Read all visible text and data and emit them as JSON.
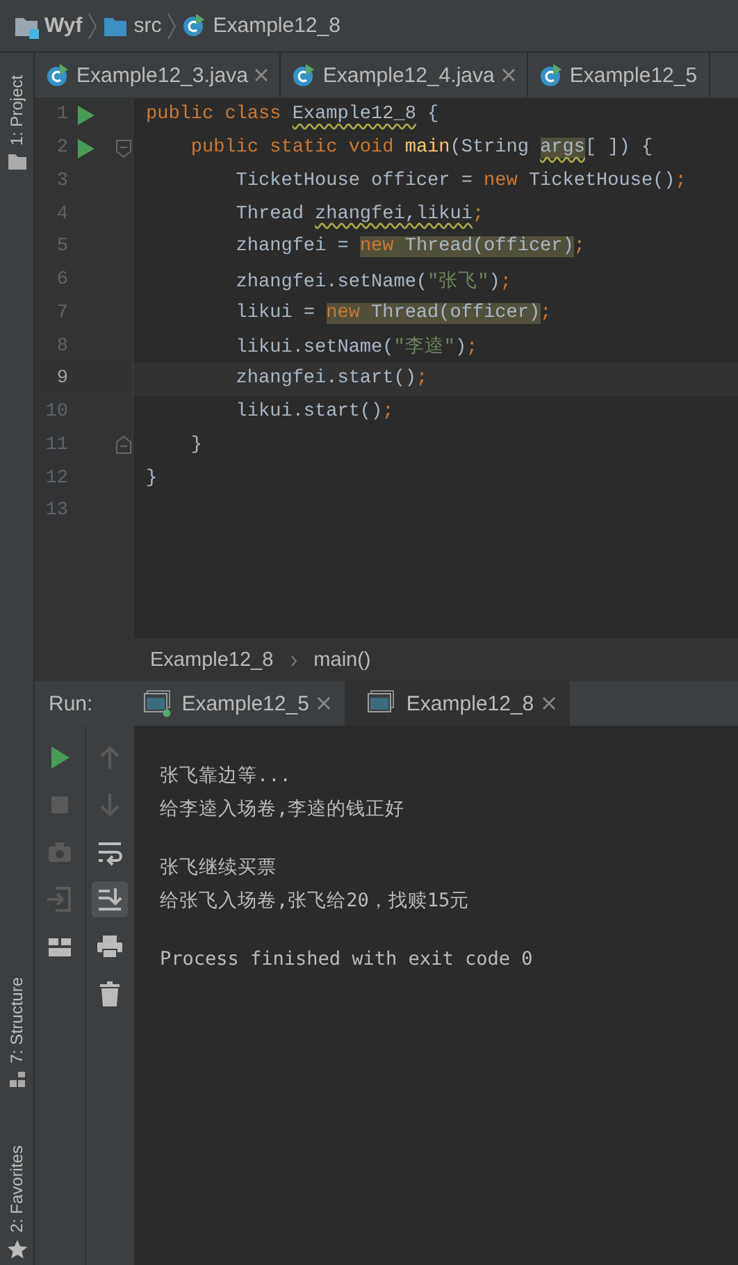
{
  "breadcrumbs": [
    {
      "label": "Wyf",
      "kind": "project"
    },
    {
      "label": "src",
      "kind": "folder"
    },
    {
      "label": "Example12_8",
      "kind": "class"
    }
  ],
  "side_tools": [
    {
      "label": "1: Project",
      "kind": "project"
    },
    {
      "label": "7: Structure",
      "kind": "structure"
    },
    {
      "label": "2: Favorites",
      "kind": "favorites"
    }
  ],
  "editor_tabs": [
    {
      "label": "Example12_3.java",
      "selected": false
    },
    {
      "label": "Example12_4.java",
      "selected": false
    },
    {
      "label": "Example12_5",
      "selected": false
    }
  ],
  "code": [
    {
      "number": "1",
      "run": true,
      "current": false,
      "segments": [
        {
          "t": "public class ",
          "kind": "kw"
        },
        {
          "t": "Example12_8",
          "kind": "warn"
        },
        {
          "t": " {",
          "kind": "txt"
        }
      ]
    },
    {
      "number": "2",
      "run": true,
      "fold": {
        "kind": "start"
      },
      "current": false,
      "segments": [
        {
          "t": "    public static void ",
          "kind": "kw"
        },
        {
          "t": "main",
          "kind": "fn"
        },
        {
          "t": "(String ",
          "kind": "txt"
        },
        {
          "t": "args",
          "kind": "warn-hl"
        },
        {
          "t": "[ ]) {",
          "kind": "txt"
        }
      ]
    },
    {
      "number": "3",
      "run": false,
      "current": false,
      "segments": [
        {
          "t": "        TicketHouse officer = ",
          "kind": "txt"
        },
        {
          "t": "new ",
          "kind": "kw"
        },
        {
          "t": "TicketHouse()",
          "kind": "txt"
        },
        {
          "t": ";",
          "kind": "semi"
        }
      ]
    },
    {
      "number": "4",
      "run": false,
      "current": false,
      "segments": [
        {
          "t": "        Thread ",
          "kind": "txt"
        },
        {
          "t": "zhangfei,likui",
          "kind": "warn"
        },
        {
          "t": ";",
          "kind": "semi"
        }
      ]
    },
    {
      "number": "5",
      "run": false,
      "current": false,
      "segments": [
        {
          "t": "        zhangfei = ",
          "kind": "txt"
        },
        {
          "t": "new ",
          "kind": "kw-hl"
        },
        {
          "t": "Thread(officer)",
          "kind": "txt-hl"
        },
        {
          "t": ";",
          "kind": "semi"
        }
      ]
    },
    {
      "number": "6",
      "run": false,
      "current": false,
      "segments": [
        {
          "t": "        zhangfei.setName(",
          "kind": "txt"
        },
        {
          "t": "\"张飞\"",
          "kind": "str"
        },
        {
          "t": ")",
          "kind": "txt"
        },
        {
          "t": ";",
          "kind": "semi"
        }
      ]
    },
    {
      "number": "7",
      "run": false,
      "current": false,
      "segments": [
        {
          "t": "        likui = ",
          "kind": "txt"
        },
        {
          "t": "new ",
          "kind": "kw-hl"
        },
        {
          "t": "Thread(officer)",
          "kind": "txt-hl"
        },
        {
          "t": ";",
          "kind": "semi"
        }
      ]
    },
    {
      "number": "8",
      "run": false,
      "current": false,
      "segments": [
        {
          "t": "        likui.setName(",
          "kind": "txt"
        },
        {
          "t": "\"李逵\"",
          "kind": "str"
        },
        {
          "t": ")",
          "kind": "txt"
        },
        {
          "t": ";",
          "kind": "semi"
        }
      ]
    },
    {
      "number": "9",
      "run": false,
      "current": true,
      "segments": [
        {
          "t": "        zhangfei.start()",
          "kind": "txt"
        },
        {
          "t": ";",
          "kind": "semi"
        }
      ]
    },
    {
      "number": "10",
      "run": false,
      "current": false,
      "segments": [
        {
          "t": "        likui.start()",
          "kind": "txt"
        },
        {
          "t": ";",
          "kind": "semi"
        }
      ]
    },
    {
      "number": "11",
      "run": false,
      "fold": {
        "kind": "end"
      },
      "current": false,
      "segments": [
        {
          "t": "    }",
          "kind": "txt"
        }
      ]
    },
    {
      "number": "12",
      "run": false,
      "current": false,
      "segments": [
        {
          "t": "}",
          "kind": "txt"
        }
      ]
    },
    {
      "number": "13",
      "run": false,
      "current": false
    }
  ],
  "code_path": [
    "Example12_8",
    "main()"
  ],
  "run_panel": {
    "label": "Run:",
    "tabs": [
      {
        "label": "Example12_5",
        "selected": false,
        "running": true
      },
      {
        "label": "Example12_8",
        "selected": true,
        "running": false
      }
    ],
    "left_tools": [
      {
        "kind": "run"
      },
      {
        "kind": "stop"
      },
      {
        "kind": "camera"
      },
      {
        "kind": "enter"
      },
      {
        "kind": "layout"
      }
    ],
    "right_tools": [
      {
        "kind": "up",
        "on": false
      },
      {
        "kind": "down",
        "on": false
      },
      {
        "kind": "wrap",
        "on": false
      },
      {
        "kind": "scroll-end",
        "on": true
      },
      {
        "kind": "print",
        "on": false
      },
      {
        "kind": "trash",
        "on": false
      }
    ],
    "output": [
      [
        "张飞靠边等...",
        "给李逵入场卷,李逵的钱正好"
      ],
      [
        "张飞继续买票",
        "给张飞入场卷,张飞给20，找赎15元"
      ],
      [
        "Process finished with exit code 0"
      ]
    ]
  }
}
